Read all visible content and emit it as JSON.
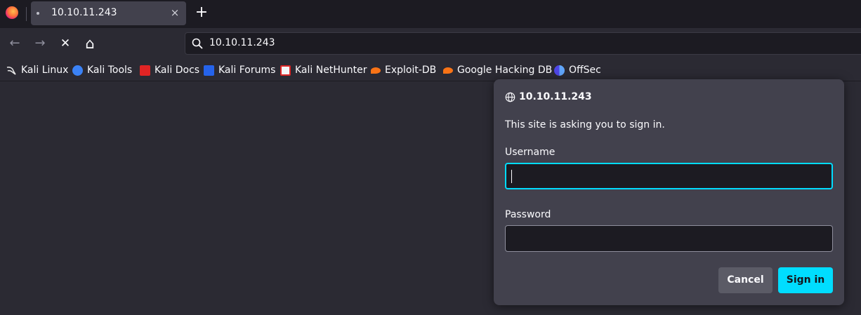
{
  "tab": {
    "title": "10.10.11.243",
    "close_glyph": "×"
  },
  "new_tab_glyph": "+",
  "nav": {
    "back_glyph": "←",
    "forward_glyph": "→",
    "stop_glyph": "✕",
    "home_glyph": "⌂"
  },
  "urlbar": {
    "value": "10.10.11.243"
  },
  "bookmarks": [
    {
      "label": "Kali Linux",
      "icon": "kali-dragon-icon",
      "color": "#e8e8e8"
    },
    {
      "label": "Kali Tools",
      "icon": "kali-tools-icon",
      "color": "#3b82f6"
    },
    {
      "label": "Kali Docs",
      "icon": "kali-docs-icon",
      "color": "#e02424"
    },
    {
      "label": "Kali Forums",
      "icon": "kali-forums-icon",
      "color": "#2563eb"
    },
    {
      "label": "Kali NetHunter",
      "icon": "kali-nethunter-icon",
      "color": "#dc2626"
    },
    {
      "label": "Exploit-DB",
      "icon": "exploit-db-icon",
      "color": "#f97316"
    },
    {
      "label": "Google Hacking DB",
      "icon": "ghdb-icon",
      "color": "#f97316"
    },
    {
      "label": "OffSec",
      "icon": "offsec-icon",
      "color": "#4f46e5"
    }
  ],
  "dialog": {
    "host": "10.10.11.243",
    "message": "This site is asking you to sign in.",
    "username_label": "Username",
    "username_value": "",
    "password_label": "Password",
    "password_value": "",
    "cancel_label": "Cancel",
    "signin_label": "Sign in"
  },
  "colors": {
    "accent": "#00ddff",
    "dialog_bg": "#42414d",
    "page_bg": "#2b2a33",
    "toolbar_bg": "#1c1b22"
  }
}
